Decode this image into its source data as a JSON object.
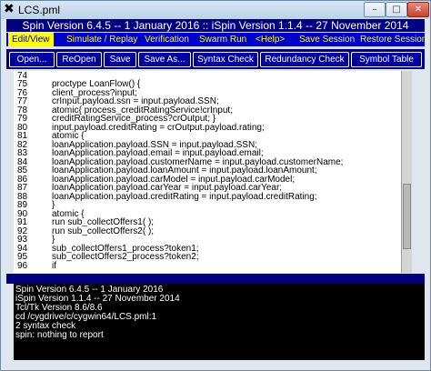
{
  "window": {
    "title": "LCS.pml",
    "app_icon": "x-logo-icon",
    "minimize": "–",
    "maximize": "□",
    "close": "✕"
  },
  "banner": "Spin Version 6.4.5 -- 1 January 2016 :: iSpin Version 1.1.4 -- 27 November 2014",
  "menu": [
    "Edit/View",
    "Simulate / Replay",
    "Verification",
    "Swarm Run",
    "<Help>",
    "Save Session",
    "Restore Session"
  ],
  "toolbar": [
    "Open...",
    "ReOpen",
    "Save",
    "Save As...",
    "Syntax Check",
    "Redundancy Check",
    "Symbol Table"
  ],
  "editor": {
    "lines": [
      {
        "n": "74",
        "text": ""
      },
      {
        "n": "75",
        "text": "proctype LoanFlow() {"
      },
      {
        "n": "76",
        "text": "client_process?input;"
      },
      {
        "n": "77",
        "text": "crInput.payload.ssn = input.payload.SSN;"
      },
      {
        "n": "78",
        "text": "atomic{ process_creditRatingService!crInput;"
      },
      {
        "n": "79",
        "text": "creditRatingService_process?crOutput; }"
      },
      {
        "n": "80",
        "text": "input.payload.creditRating = crOutput.payload.rating;"
      },
      {
        "n": "81",
        "text": "atomic {"
      },
      {
        "n": "82",
        "text": "loanApplication.payload.SSN = input.payload.SSN;"
      },
      {
        "n": "83",
        "text": "loanApplication.payload.email = input.payload.email;"
      },
      {
        "n": "84",
        "text": "loanApplication.payload.customerName = input.payload.customerName;"
      },
      {
        "n": "85",
        "text": "loanApplication.payload.loanAmount = input.payload.loanAmount;"
      },
      {
        "n": "86",
        "text": "loanApplication.payload.carModel = input.payload.carModel;"
      },
      {
        "n": "87",
        "text": "loanApplication.payload.carYear = input.payload.carYear;"
      },
      {
        "n": "88",
        "text": "loanApplication.payload.creditRating = input.payload.creditRating;"
      },
      {
        "n": "89",
        "text": "}"
      },
      {
        "n": "90",
        "text": "atomic {"
      },
      {
        "n": "91",
        "text": "run sub_collectOffers1( );"
      },
      {
        "n": "92",
        "text": "run sub_collectOffers2( );"
      },
      {
        "n": "93",
        "text": "}"
      },
      {
        "n": "94",
        "text": "sub_collectOffers1_process?token1;"
      },
      {
        "n": "95",
        "text": "sub_collectOffers2_process?token2;"
      },
      {
        "n": "96",
        "text": "if"
      }
    ]
  },
  "console": [
    "Spin Version 6.4.5 -- 1 January 2016",
    "iSpin Version 1.1.4 -- 27 November 2014",
    "Tcl/Tk Version 8.6/8.6",
    "cd /cygdrive/c/cygwin64/LCS.pml:1",
    "2 syntax check",
    "spin: nothing to report"
  ]
}
